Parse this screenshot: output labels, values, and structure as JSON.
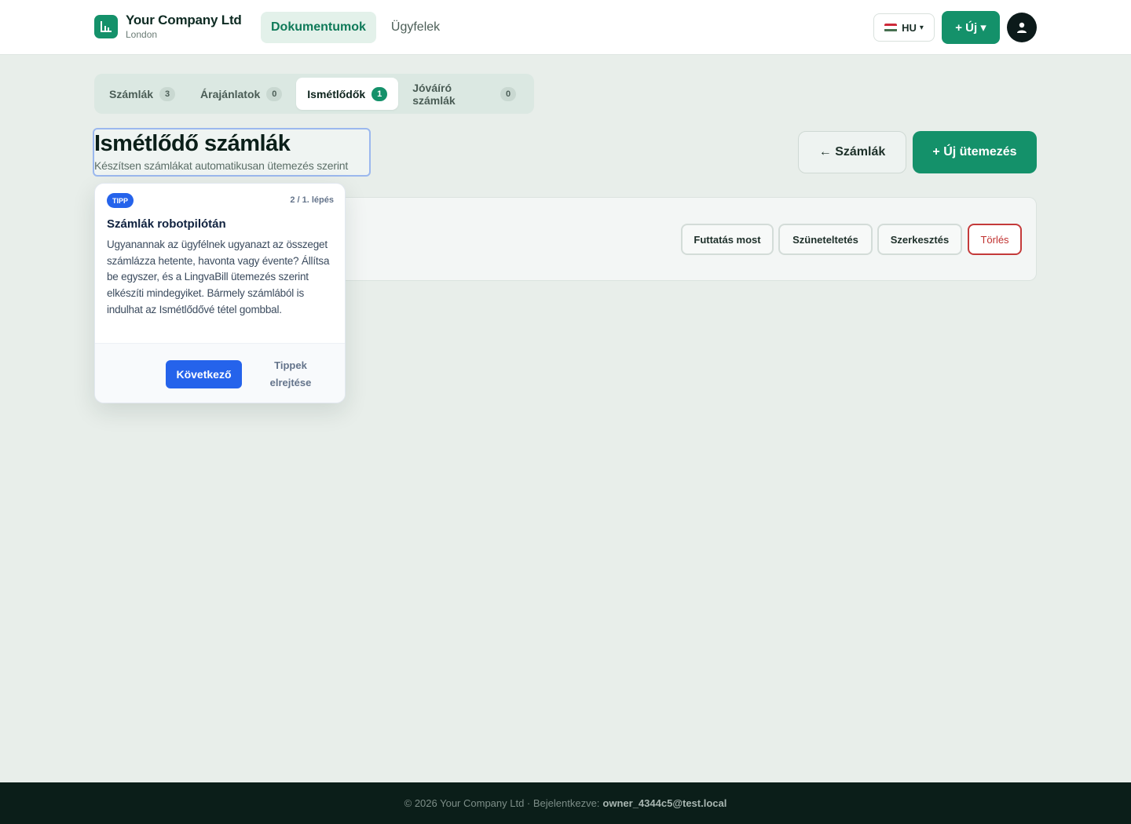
{
  "brand": {
    "name": "Your Company Ltd",
    "location": "London",
    "logo_icon": "bar-chart-icon",
    "accent": "#14916a"
  },
  "nav": {
    "items": [
      {
        "label": "Dokumentumok",
        "active": true
      },
      {
        "label": "Ügyfelek",
        "active": false
      }
    ]
  },
  "header": {
    "language": "HU",
    "language_flag": "hungary-flag-icon",
    "new_button": "+ Új ▾",
    "avatar_icon": "user-icon"
  },
  "tabs": [
    {
      "label": "Számlák",
      "count": "3",
      "active": false
    },
    {
      "label": "Árajánlatok",
      "count": "0",
      "active": false
    },
    {
      "label": "Ismétlődők",
      "count": "1",
      "active": true
    },
    {
      "label": "Jóváíró számlák",
      "count": "0",
      "active": false
    }
  ],
  "page": {
    "title": "Ismétlődő számlák",
    "subtitle": "Készítsen számlákat automatikusan ütemezés szerint",
    "back_button": "← Számlák",
    "schedule_button": "+ Új ütemezés"
  },
  "card": {
    "actions": {
      "run": "Futtatás most",
      "pause": "Szüneteltetés",
      "edit": "Szerkesztés",
      "delete": "Törlés"
    }
  },
  "tip": {
    "badge": "TIPP",
    "step": "2 / 1. lépés",
    "title": "Számlák robotpilótán",
    "body": "Ugyanannak az ügyfélnek ugyanazt az összeget számlázza hetente, havonta vagy évente? Állítsa be egyszer, és a LingvaBill ütemezés szerint elkészíti mindegyiket. Bármely számlából is indulhat az Ismétlődővé tétel gombbal.",
    "next_button": "Következő",
    "dismiss_button": "Tippek elrejtése",
    "accent": "#2563eb"
  },
  "footer": {
    "text": "© 2026 Your Company Ltd · Bejelentkezve:",
    "user": "owner_4344c5@test.local"
  }
}
